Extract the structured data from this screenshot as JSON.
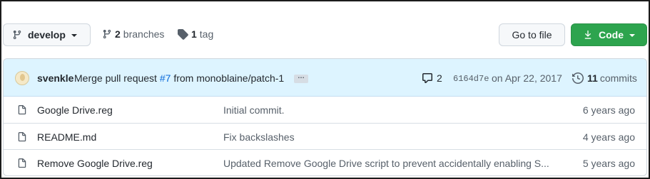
{
  "toolbar": {
    "branch_label": "develop",
    "branches_count": "2",
    "branches_label": "branches",
    "tags_count": "1",
    "tags_label": "tag",
    "go_to_file_label": "Go to file",
    "code_label": "Code"
  },
  "latest_commit": {
    "author": "svenkle",
    "message_prefix": "Merge pull request",
    "pr_number": "#7",
    "message_suffix": "from monoblaine/patch-1",
    "ellipsis": "…",
    "comments_count": "2",
    "sha": "6164d7e",
    "date": "on Apr 22, 2017",
    "commits_count": "11",
    "commits_label": "commits"
  },
  "files": [
    {
      "name": "Google Drive.reg",
      "message": "Initial commit.",
      "age": "6 years ago"
    },
    {
      "name": "README.md",
      "message": "Fix backslashes",
      "age": "4 years ago"
    },
    {
      "name": "Remove Google Drive.reg",
      "message": "Updated Remove Google Drive script to prevent accidentally enabling S...",
      "age": "5 years ago"
    }
  ],
  "icons": {
    "branch": "git-branch-icon",
    "tag": "tag-icon",
    "download": "download-icon",
    "comment": "comment-icon",
    "history": "history-icon",
    "file": "file-icon"
  },
  "colors": {
    "code_button": "#2da44e",
    "commit_bar": "#ddf4ff",
    "link": "#0969da"
  }
}
